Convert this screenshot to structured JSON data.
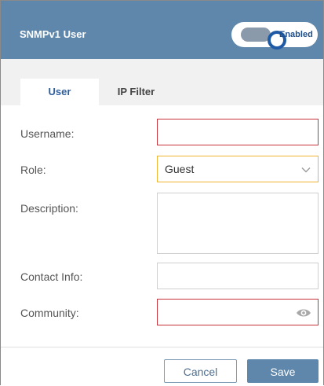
{
  "dialog": {
    "title": "SNMPv1 User",
    "toggle": {
      "label": "Enabled",
      "state": "on"
    }
  },
  "tabs": [
    {
      "label": "User",
      "active": true
    },
    {
      "label": "IP Filter",
      "active": false
    }
  ],
  "form": {
    "username": {
      "label": "Username:",
      "value": ""
    },
    "role": {
      "label": "Role:",
      "value": "Guest"
    },
    "description": {
      "label": "Description:",
      "value": ""
    },
    "contact_info": {
      "label": "Contact Info:",
      "value": ""
    },
    "community": {
      "label": "Community:",
      "value": ""
    }
  },
  "buttons": {
    "cancel_label": "Cancel",
    "save_label": "Save"
  },
  "colors": {
    "header": "#5f87ab",
    "error_border": "#c8323a",
    "warning_border": "#f0b430",
    "toggle_accent": "#1f5aa6"
  },
  "icons": {
    "role_dropdown": "chevron-down-icon",
    "community_visibility": "eye-icon"
  }
}
